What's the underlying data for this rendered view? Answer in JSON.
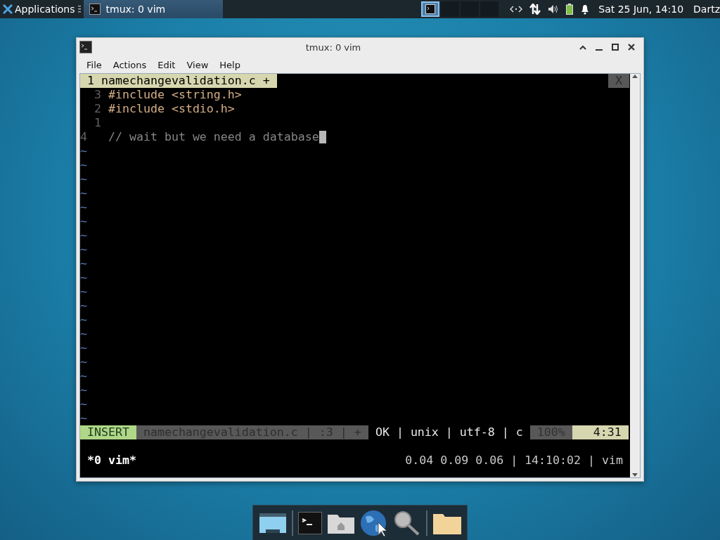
{
  "top_panel": {
    "applications": "Applications",
    "task": {
      "label": "tmux: 0 vim",
      "selected": true
    },
    "workspaces": [
      {
        "selected": true
      },
      {
        "selected": false
      },
      {
        "selected": false
      },
      {
        "selected": false
      }
    ],
    "clock": "Sat 25 Jun, 14:10",
    "user": "Dartz"
  },
  "window": {
    "title": "tmux: 0 vim",
    "menu": [
      "File",
      "Actions",
      "Edit",
      "View",
      "Help"
    ],
    "vim": {
      "tab": {
        "label": "1 namechangevalidation.c +",
        "selected": true
      },
      "close": "X",
      "lines": [
        {
          "kind": "code",
          "number": "3",
          "text": "#include <string.h>"
        },
        {
          "kind": "code",
          "number": "2",
          "text": "#include <stdio.h>"
        },
        {
          "kind": "code",
          "number": "1"
        },
        {
          "kind": "current",
          "number": "4",
          "text": "// wait but we need a database",
          "cursor": true
        }
      ],
      "tildes": [
        "~",
        "~",
        "~",
        "~",
        "~",
        "~",
        "~",
        "~",
        "~",
        "~",
        "~",
        "~",
        "~",
        "~",
        "~",
        "~",
        "~",
        "~",
        "~",
        "~"
      ],
      "statusline": {
        "mode": "INSERT",
        "file": "namechangevalidation.c | :3 | +",
        "info": "OK | unix | utf-8 | c",
        "percent": "100%",
        "position": "4:31"
      }
    },
    "tmux": {
      "window": "*0 vim*",
      "status": "0.04 0.09 0.06 | 14:10:02 | vim"
    }
  }
}
